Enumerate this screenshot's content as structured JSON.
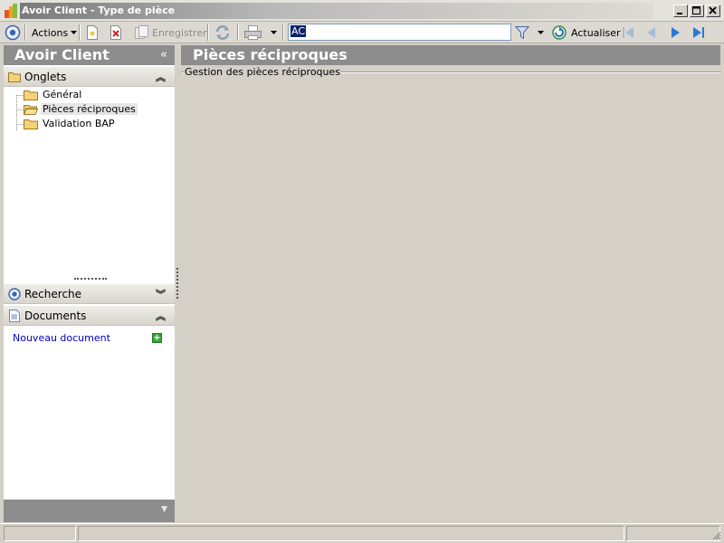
{
  "window": {
    "title": "Avoir Client -  Type de pièce"
  },
  "toolbar": {
    "actions_label": "Actions",
    "save_label": "Enregistrer",
    "search_value": "AC",
    "refresh_label": "Actualiser"
  },
  "left": {
    "title": "Avoir Client",
    "tabs_section": "Onglets",
    "tree_items": [
      {
        "label": "Général"
      },
      {
        "label": "Pièces réciproques"
      },
      {
        "label": "Validation BAP"
      }
    ],
    "search_section": "Recherche",
    "documents_section": "Documents",
    "new_document": "Nouveau document"
  },
  "main": {
    "title": "Pièces réciproques",
    "group_label": "Gestion des pièces réciproques"
  },
  "colors": {
    "header_gray": "#8d8d8d",
    "link_blue": "#0000c0",
    "selection_blue": "#0a246a"
  }
}
